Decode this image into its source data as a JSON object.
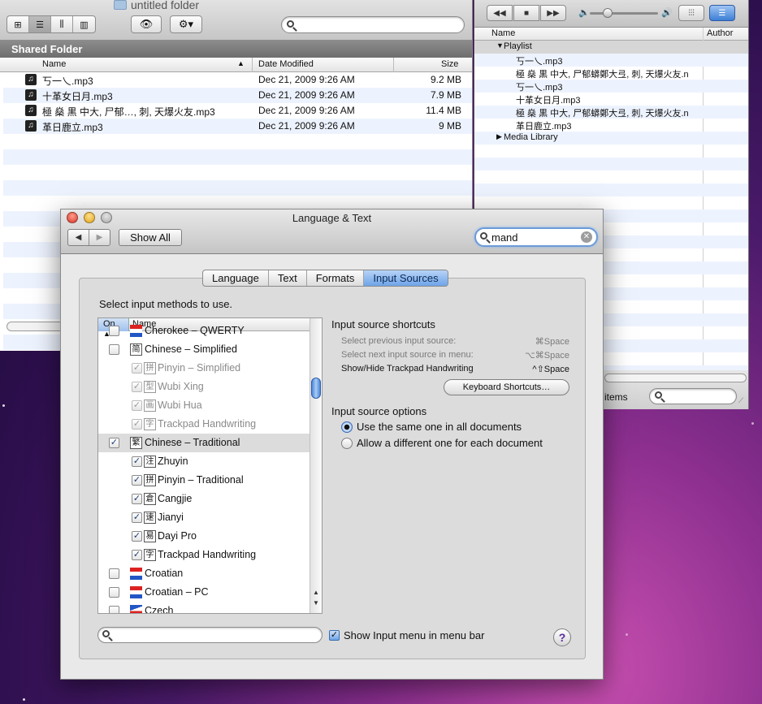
{
  "finder": {
    "folder_title": "untitled folder",
    "shared_header": "Shared Folder",
    "columns": {
      "name": "Name",
      "date": "Date Modified",
      "size": "Size"
    },
    "files": [
      {
        "name": "丂一乀.mp3",
        "date": "Dec 21, 2009 9:26 AM",
        "size": "9.2 MB"
      },
      {
        "name": "十革女日月.mp3",
        "date": "Dec 21, 2009 9:26 AM",
        "size": "7.9 MB"
      },
      {
        "name": "極 燊 黒 中大, 尸郁…, 刺, 天爆火友.mp3",
        "date": "Dec 21, 2009 9:26 AM",
        "size": "11.4 MB"
      },
      {
        "name": "革日鹿立.mp3",
        "date": "Dec 21, 2009 9:26 AM",
        "size": "9 MB"
      }
    ]
  },
  "itunes": {
    "columns": {
      "name": "Name",
      "author": "Author"
    },
    "playlist_label": "Playlist",
    "items": [
      "丂一乀.mp3",
      "極 燊 黒 中大, 尸郁蟒鄭大弖, 刺, 天爆火友.n",
      "丂一乀.mp3",
      "十革女日月.mp3",
      "極 燊 黒 中大, 尸郁蟒鄭大弖, 刺, 天爆火友.n",
      "革日鹿立.mp3"
    ],
    "media_library_label": "Media Library",
    "bottom_items_label": "items"
  },
  "lang_window": {
    "title": "Language & Text",
    "show_all": "Show All",
    "search_value": "mand",
    "tabs": [
      "Language",
      "Text",
      "Formats",
      "Input Sources"
    ],
    "select_label": "Select input methods to use.",
    "list_head": {
      "on": "On",
      "name": "Name"
    },
    "methods": {
      "cherokee": "Cherokee – QWERTY",
      "chinese_simplified": "Chinese – Simplified",
      "pinyin_simplified": "Pinyin – Simplified",
      "wubi_xing": "Wubi Xing",
      "wubi_hua": "Wubi Hua",
      "trackpad_hw_1": "Trackpad Handwriting",
      "chinese_traditional": "Chinese – Traditional",
      "zhuyin": "Zhuyin",
      "pinyin_traditional": "Pinyin – Traditional",
      "cangjie": "Cangjie",
      "jianyi": "Jianyi",
      "dayi_pro": "Dayi Pro",
      "trackpad_hw_2": "Trackpad Handwriting",
      "croatian": "Croatian",
      "croatian_pc": "Croatian – PC",
      "czech": "Czech"
    },
    "method_glyphs": {
      "chinese_simplified": "简",
      "pinyin_simplified": "拼",
      "wubi_xing": "型",
      "wubi_hua": "画",
      "trackpad_hw_1": "字",
      "chinese_traditional": "繁",
      "zhuyin": "注",
      "pinyin_traditional": "拼",
      "cangjie": "倉",
      "jianyi": "速",
      "dayi_pro": "易",
      "trackpad_hw_2": "字"
    },
    "shortcuts_title": "Input source shortcuts",
    "shortcuts": [
      {
        "label": "Select previous input source:",
        "key": "⌘Space"
      },
      {
        "label": "Select next input source in menu:",
        "key": "⌥⌘Space"
      },
      {
        "label": "Show/Hide Trackpad Handwriting",
        "key": "^⇧Space"
      }
    ],
    "keyboard_shortcuts_button": "Keyboard Shortcuts…",
    "options_title": "Input source options",
    "option_same": "Use the same one in all documents",
    "option_different": "Allow a different one for each document",
    "show_menu_label": "Show Input menu in menu bar",
    "help": "?"
  }
}
